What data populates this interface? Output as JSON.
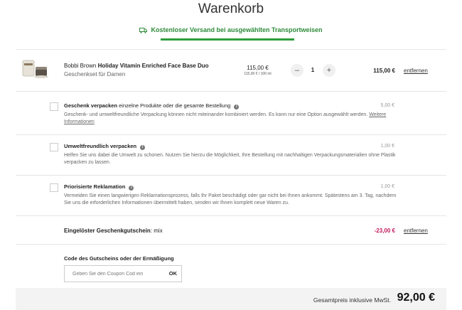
{
  "page": {
    "title": "Warenkorb",
    "shipping_notice": "Kostenloser Versand bei ausgewählten Transportweisen"
  },
  "product": {
    "brand": "Bobbi Brown",
    "name": "Holiday Vitamin Enriched Face Base Duo",
    "subtitle": "Geschenkset für Damen",
    "price": "115,00 €",
    "unit_price": "115,00 € / 100 ml",
    "quantity": "1",
    "minus": "–",
    "plus": "+",
    "total": "115,00 €",
    "remove_label": "entfernen"
  },
  "options": [
    {
      "title": "Geschenk verpacken",
      "title_suffix": "einzelne Produkte oder die gesamte Bestellung",
      "description": "Geschenk- und umweltfreundliche Verpackung können nicht miteinander kombiniert werden. Es kann nur eine Option ausgewählt werden.",
      "link": "Weitere Informationen",
      "price": "5,00 €",
      "checked": false
    },
    {
      "title": "Umweltfreundlich verpacken",
      "title_suffix": "",
      "description": "Helfen Sie uns dabei die Umwelt zu schonen. Nutzen Sie hierzu die Möglichkeit, Ihre Bestellung mit nachhaltigen Verpackungsmaterialien ohne Plastik verpacken zu lassen.",
      "link": "",
      "price": "1,00 €",
      "checked": false
    },
    {
      "title": "Priorisierte Reklamation",
      "title_suffix": "",
      "description": "Vermeiden Sie einen langwierigen Reklamationsprozess, falls Ihr Paket beschädigt oder gar nicht bei Ihnen ankommt. Spätestens am 3. Tag, nachdem Sie uns die erforderlichen Informationen übermittelt haben, senden wir Ihnen komplett neue Waren zu.",
      "link": "",
      "price": "1,00 €",
      "checked": false
    }
  ],
  "voucher": {
    "label": "Eingelöster Geschenkgutschein",
    "code": ": mix",
    "amount": "-23,00 €",
    "remove_label": "entfernen"
  },
  "coupon": {
    "label": "Code des Gutscheins oder der Ermäßigung",
    "placeholder": "Geben Sie den Coupon Cod ein",
    "button": "OK"
  },
  "total": {
    "label": "Gesamtpreis inklusive MwSt.",
    "value": "92,00 €"
  },
  "colors": {
    "accent_green": "#2e8b3a",
    "voucher_red": "#c2185b"
  },
  "icons": {
    "shipping": "truck-icon",
    "info": "info-icon"
  }
}
